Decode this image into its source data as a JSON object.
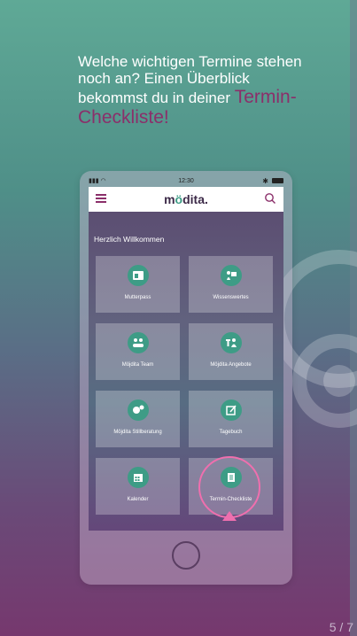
{
  "headline": {
    "text": "Welche wichtigen Termine stehen noch an? Einen Überblick bekommst du in deiner",
    "accent": "Termin-Checkliste!"
  },
  "phone": {
    "status_bar": {
      "time": "12:30",
      "bluetooth": "✱"
    },
    "app_bar": {
      "menu_icon": "hamburger-menu-icon",
      "logo": {
        "prefix": "m",
        "o": "ö",
        "suffix": "dita."
      },
      "search_icon": "search-icon"
    },
    "welcome": "Herzlich Willkommen",
    "tiles": [
      {
        "label": "Mutterpass",
        "icon": "id-card-icon"
      },
      {
        "label": "Wissenswertes",
        "icon": "info-icon"
      },
      {
        "label": "Möjdita Team",
        "icon": "team-icon"
      },
      {
        "label": "Möjdita Angebote",
        "icon": "offers-icon"
      },
      {
        "label": "Möjdita Stillberatung",
        "icon": "breastfeeding-icon"
      },
      {
        "label": "Tagebuch",
        "icon": "diary-icon"
      },
      {
        "label": "Kalender",
        "icon": "calendar-icon"
      },
      {
        "label": "Termin-Checkliste",
        "icon": "checklist-icon"
      }
    ]
  },
  "page_indicator": "5 / 7",
  "colors": {
    "accent": "#8b2f6a",
    "tile_icon": "#3e9c86",
    "highlight": "#ef6fae"
  }
}
